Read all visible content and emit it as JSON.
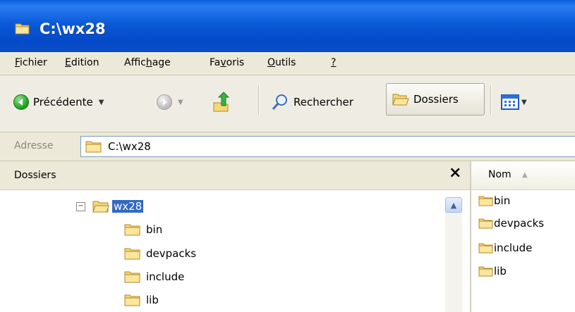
{
  "window": {
    "title": "C:\\wx28"
  },
  "menu": [
    {
      "pre": "",
      "u": "F",
      "post": "ichier"
    },
    {
      "pre": "",
      "u": "E",
      "post": "dition"
    },
    {
      "pre": "Affic",
      "u": "h",
      "post": "age"
    },
    {
      "pre": "Fa",
      "u": "v",
      "post": "oris"
    },
    {
      "pre": "",
      "u": "O",
      "post": "utils"
    },
    {
      "pre": "",
      "u": "?",
      "post": ""
    }
  ],
  "toolbar": {
    "back_label": "Précédente",
    "search_label": "Rechercher",
    "folders_label": "Dossiers"
  },
  "address": {
    "label": "Adresse",
    "value": "C:\\wx28"
  },
  "folders_pane": {
    "title": "Dossiers",
    "close": "×",
    "tree": {
      "root": "wx28",
      "children": [
        "bin",
        "devpacks",
        "include",
        "lib"
      ]
    }
  },
  "file_list": {
    "column": "Nom",
    "items": [
      "bin",
      "devpacks",
      "include",
      "lib"
    ]
  },
  "colors": {
    "titlebar": "#0a5ad8",
    "selection": "#316ac5",
    "folder": "#f5d77a"
  }
}
